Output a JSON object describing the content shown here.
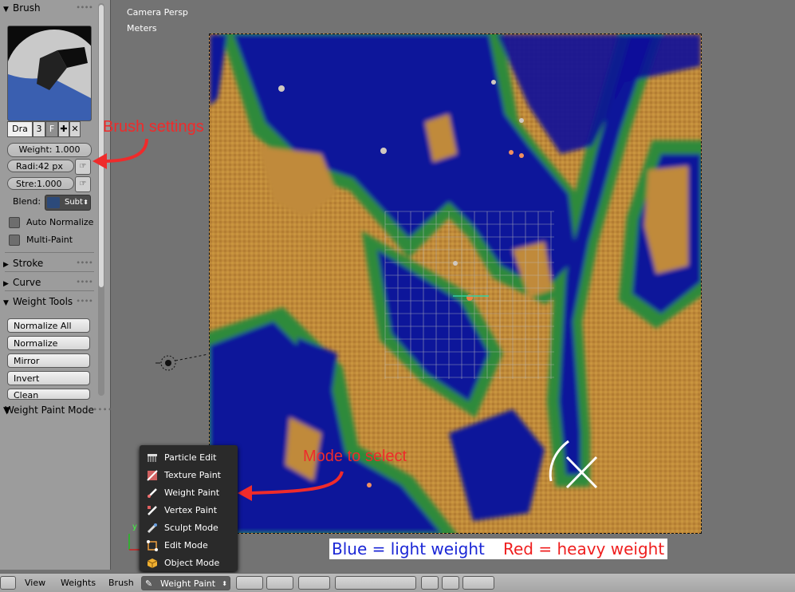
{
  "shelf": {
    "brush_panel": "Brush",
    "brush_name": "Dra",
    "brush_users": "3",
    "brush_fake": "F",
    "weight_field": "Weight:  1.000",
    "radius_field": "Radi:42 px",
    "strength_field": "Stre:1.000",
    "blend_label": "Blend:",
    "blend_value": "Subt",
    "auto_normalize": "Auto Normalize",
    "multi_paint": "Multi-Paint",
    "stroke_panel": "Stroke",
    "curve_panel": "Curve",
    "weight_tools_panel": "Weight Tools",
    "tools": [
      "Normalize All",
      "Normalize",
      "Mirror",
      "Invert",
      "Clean"
    ],
    "operator_panel": "Weight Paint Mode"
  },
  "viewport": {
    "view_name": "Camera Persp",
    "units": "Meters",
    "axis_y": "y",
    "legend_blue": "Blue = light weight",
    "legend_red": "Red = heavy weight",
    "annotation_brush": "Brush settings",
    "annotation_mode": "Mode to select"
  },
  "mode_menu": {
    "items": [
      "Particle Edit",
      "Texture Paint",
      "Weight Paint",
      "Vertex Paint",
      "Sculpt Mode",
      "Edit Mode",
      "Object Mode"
    ]
  },
  "footer": {
    "view": "View",
    "weights": "Weights",
    "brush": "Brush",
    "mode": "Weight Paint"
  },
  "colors": {
    "light_weight": "#1b27d6",
    "heavy_weight": "#ef1f1f",
    "annotation": "#ef2b2b",
    "terrain_orange": "#c08a3a",
    "terrain_blue": "#0e129a",
    "terrain_green": "#2f8a3a"
  },
  "icons": {
    "particle_edit": "particle-comb-icon",
    "texture_paint": "texture-brush-icon",
    "weight_paint": "weight-brush-icon",
    "vertex_paint": "vertex-brush-icon",
    "sculpt_mode": "sculpt-brush-icon",
    "edit_mode": "edit-mesh-icon",
    "object_mode": "object-cube-icon"
  }
}
